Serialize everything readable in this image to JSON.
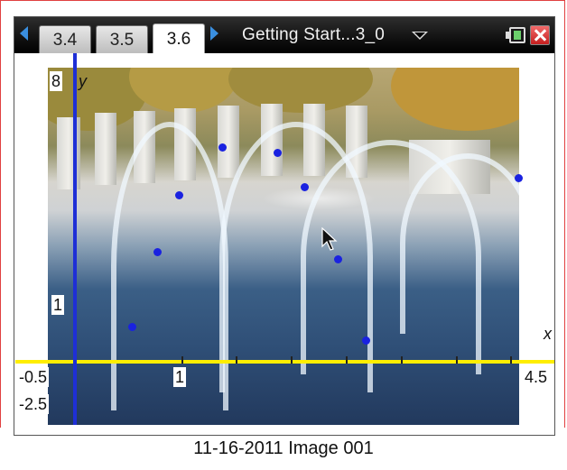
{
  "tabs": [
    {
      "label": "3.4",
      "active": false
    },
    {
      "label": "3.5",
      "active": false
    },
    {
      "label": "3.6",
      "active": true
    }
  ],
  "document": {
    "title": "Getting Start...3_0"
  },
  "icons": {
    "prev": "left-arrow-icon",
    "next": "right-arrow-icon",
    "battery": "battery-icon",
    "close": "close-icon",
    "menu": "dropdown-caret-icon",
    "pointer": "mouse-pointer-icon"
  },
  "graph": {
    "y_axis_label": "y",
    "x_axis_label": "x",
    "y_top_label": "8",
    "y_one_label": "1",
    "x_min_label": "-0.5",
    "x_one_label": "1",
    "x_max_label": "4.5",
    "y_min_label": "-2.5",
    "axis_colors": {
      "x": "#ffee00",
      "y": "#1e2fd6"
    },
    "point_color": "#1a22e0"
  },
  "caption": "11-16-2011 Image 001"
}
